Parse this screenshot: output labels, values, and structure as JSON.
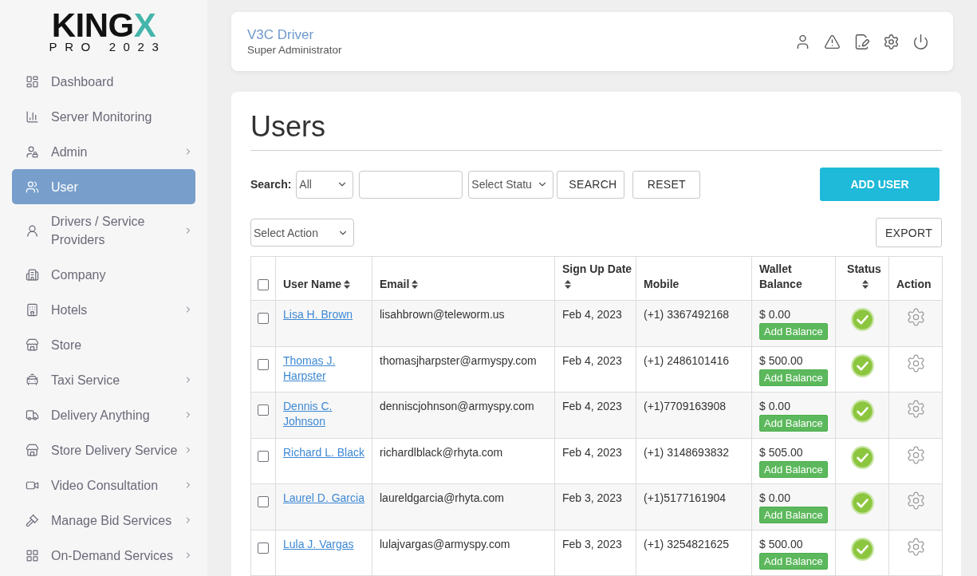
{
  "logo": {
    "name": "KING",
    "accent": "X",
    "tagline": "PRO 2023"
  },
  "sidebar": {
    "items": [
      {
        "label": "Dashboard",
        "selected": false,
        "has_submenu": false
      },
      {
        "label": "Server Monitoring",
        "selected": false,
        "has_submenu": false
      },
      {
        "label": "Admin",
        "selected": false,
        "has_submenu": true
      },
      {
        "label": "User",
        "selected": true,
        "has_submenu": false
      },
      {
        "label": "Drivers / Service Providers",
        "selected": false,
        "has_submenu": true
      },
      {
        "label": "Company",
        "selected": false,
        "has_submenu": false
      },
      {
        "label": "Hotels",
        "selected": false,
        "has_submenu": true
      },
      {
        "label": "Store",
        "selected": false,
        "has_submenu": false
      },
      {
        "label": "Taxi Service",
        "selected": false,
        "has_submenu": true
      },
      {
        "label": "Delivery Anything",
        "selected": false,
        "has_submenu": true
      },
      {
        "label": "Store Delivery Service",
        "selected": false,
        "has_submenu": true
      },
      {
        "label": "Video Consultation",
        "selected": false,
        "has_submenu": true
      },
      {
        "label": "Manage Bid Services",
        "selected": false,
        "has_submenu": true
      },
      {
        "label": "On-Demand Services",
        "selected": false,
        "has_submenu": true
      }
    ]
  },
  "header": {
    "title": "V3C Driver",
    "subtitle": "Super Administrator"
  },
  "page": {
    "title": "Users",
    "search_label": "Search:",
    "field_select": "All",
    "status_select": "Select Statu",
    "search_button": "SEARCH",
    "reset_button": "RESET",
    "add_button": "ADD USER",
    "action_select": "Select Action",
    "export_button": "EXPORT"
  },
  "table": {
    "select_all_checked": false,
    "columns": [
      {
        "label": "User Name",
        "sortable": true
      },
      {
        "label": "Email",
        "sortable": true
      },
      {
        "label": "Sign Up Date",
        "sortable": true
      },
      {
        "label": "Mobile",
        "sortable": false
      },
      {
        "label": "Wallet Balance",
        "sortable": false
      },
      {
        "label": "Status",
        "sortable": true
      },
      {
        "label": "Action",
        "sortable": false
      }
    ],
    "rows": [
      {
        "checked": false,
        "name": "Lisa H. Brown",
        "email": "lisahbrown@teleworm.us",
        "signup_date": "Feb 4, 2023",
        "mobile": "(+1) 3367492168",
        "wallet_balance": "$ 0.00",
        "add_balance": "Add Balance",
        "active": true
      },
      {
        "checked": false,
        "name": "Thomas J. Harpster",
        "email": "thomasjharpster@armyspy.com",
        "signup_date": "Feb 4, 2023",
        "mobile": "(+1) 2486101416",
        "wallet_balance": "$ 500.00",
        "add_balance": "Add Balance",
        "active": true
      },
      {
        "checked": false,
        "name": "Dennis C. Johnson",
        "email": "denniscjohnson@armyspy.com",
        "signup_date": "Feb 4, 2023",
        "mobile": "(+1)7709163908",
        "wallet_balance": "$ 0.00",
        "add_balance": "Add Balance",
        "active": true
      },
      {
        "checked": false,
        "name": "Richard L. Black",
        "email": "richardlblack@rhyta.com",
        "signup_date": "Feb 4, 2023",
        "mobile": "(+1) 3148693832",
        "wallet_balance": "$ 505.00",
        "add_balance": "Add Balance",
        "active": true
      },
      {
        "checked": false,
        "name": "Laurel D. Garcia",
        "email": "laureldgarcia@rhyta.com",
        "signup_date": "Feb 3, 2023",
        "mobile": "(+1)5177161904",
        "wallet_balance": "$ 0.00",
        "add_balance": "Add Balance",
        "active": true
      },
      {
        "checked": false,
        "name": "Lula J. Vargas",
        "email": "lulajvargas@armyspy.com",
        "signup_date": "Feb 3, 2023",
        "mobile": "(+1) 3254821625",
        "wallet_balance": "$ 500.00",
        "add_balance": "Add Balance",
        "active": true
      }
    ]
  }
}
